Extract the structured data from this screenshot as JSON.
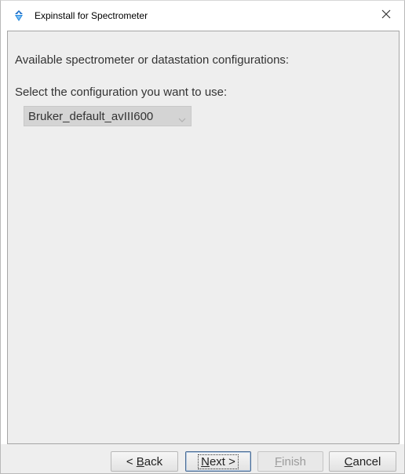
{
  "window": {
    "title": "Expinstall for Spectrometer"
  },
  "main": {
    "heading": "Available spectrometer or datastation configurations:",
    "select_label": "Select the configuration you want to use:",
    "configuration": {
      "selected": "Bruker_default_avIII600"
    }
  },
  "footer": {
    "back_prefix": "< ",
    "back_mnemonic": "B",
    "back_rest": "ack",
    "next_mnemonic": "N",
    "next_rest": "ext >",
    "finish_mnemonic": "F",
    "finish_rest": "inish",
    "cancel_mnemonic": "C",
    "cancel_rest": "ancel"
  },
  "colors": {
    "panel_bg": "#eeeeee",
    "combo_bg": "#d4d4d4",
    "default_border": "#4a6c95",
    "disabled_text": "#9c9c9c"
  },
  "icons": {
    "app": "topspin-app-icon",
    "close": "close-icon",
    "dropdown": "chevron-down-icon"
  }
}
